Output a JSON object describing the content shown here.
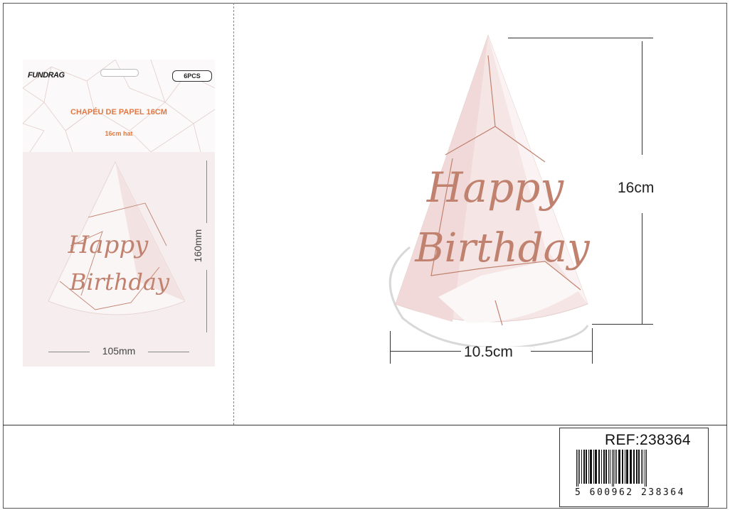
{
  "package": {
    "brand": "FUNDRAG",
    "quantity": "6PCS",
    "title": "CHAPÉU DE PAPEL 16CM",
    "subtitle": "16cm hat",
    "hat_text_line1": "Happy",
    "hat_text_line2": "Birthday",
    "height_label": "160mm",
    "width_label": "105mm"
  },
  "product": {
    "hat_text_line1": "Happy",
    "hat_text_line2": "Birthday",
    "height_label": "16cm",
    "width_label": "10.5cm"
  },
  "reference": {
    "ref_label": "REF:238364",
    "barcode_number": "5 600962 238364"
  },
  "colors": {
    "hat_pink": "#f2d9d8",
    "rose_gold": "#c0826f",
    "package_pink": "#f6eeee",
    "title_orange": "#e07a45"
  }
}
